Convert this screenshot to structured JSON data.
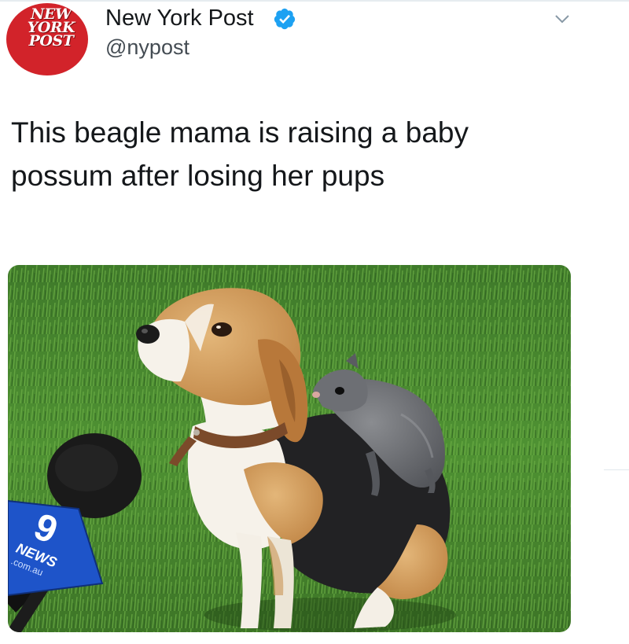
{
  "account": {
    "display_name": "New York Post",
    "handle": "@nypost",
    "verified": true,
    "avatar_lines": [
      "NEW",
      "YORK",
      "POST"
    ],
    "avatar_color": "#d2232a",
    "verified_color": "#1da1f2"
  },
  "tweet": {
    "text_line1": "This beagle mama is raising a baby",
    "text_line2": "possum after losing her pups"
  },
  "media": {
    "kind": "photo",
    "mic_logo_number": "9",
    "mic_logo_word": "NEWS",
    "mic_logo_domain": ".com.au"
  },
  "icons": {
    "verified": "verified-badge-icon",
    "menu": "chevron-down-icon"
  }
}
